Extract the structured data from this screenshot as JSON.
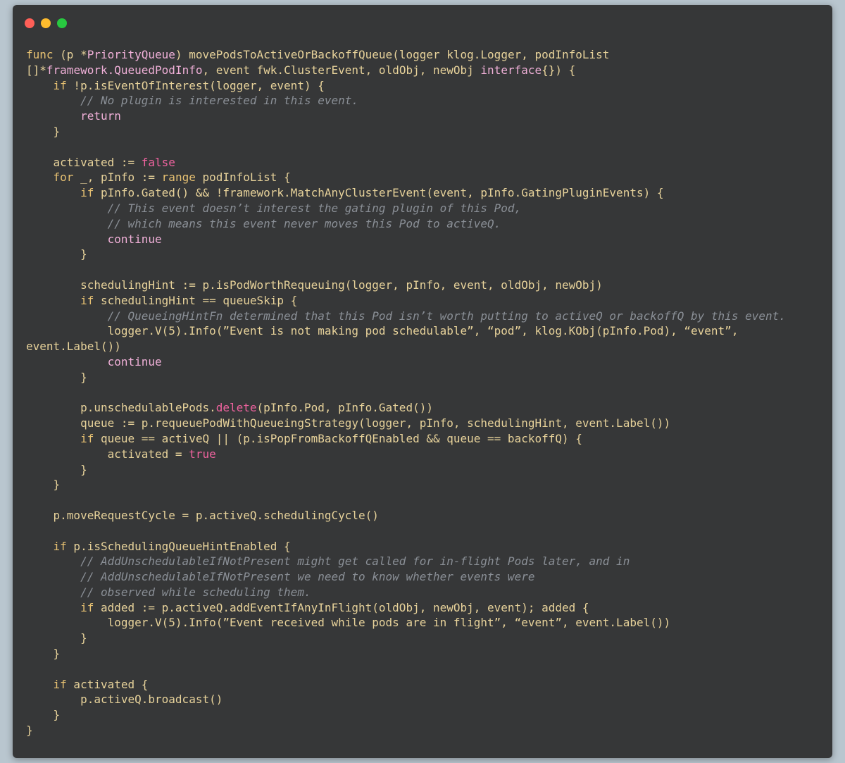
{
  "window": {
    "controls": [
      {
        "name": "close",
        "color": "#ff5f57"
      },
      {
        "name": "minimize",
        "color": "#febc2e"
      },
      {
        "name": "maximize",
        "color": "#28c840"
      }
    ]
  },
  "colors": {
    "background": "#b9c6cf",
    "editor": "#363738",
    "text": "#e7d29a",
    "keyword_pink": "#f0639f",
    "comment": "#8a8f96"
  },
  "code": {
    "language": "go",
    "lines": [
      [
        {
          "t": "func",
          "c": "kw"
        },
        {
          "t": " (p *",
          "c": "pl"
        },
        {
          "t": "PriorityQueue",
          "c": "ty"
        },
        {
          "t": ") movePodsToActiveOrBackoffQueue(logger klog.Logger, podInfoList",
          "c": "pl"
        }
      ],
      [
        {
          "t": "[]*",
          "c": "pl"
        },
        {
          "t": "framework.QueuedPodInfo",
          "c": "ty"
        },
        {
          "t": ", event fwk.ClusterEvent, oldObj, newObj ",
          "c": "pl"
        },
        {
          "t": "interface",
          "c": "ty"
        },
        {
          "t": "{}) {",
          "c": "pl"
        }
      ],
      [
        {
          "t": "    ",
          "c": "pl"
        },
        {
          "t": "if",
          "c": "kw"
        },
        {
          "t": " !p.isEventOfInterest(logger, event) {",
          "c": "pl"
        }
      ],
      [
        {
          "t": "        ",
          "c": "pl"
        },
        {
          "t": "// No plugin is interested in this event.",
          "c": "cm"
        }
      ],
      [
        {
          "t": "        ",
          "c": "pl"
        },
        {
          "t": "return",
          "c": "ty"
        }
      ],
      [
        {
          "t": "    }",
          "c": "pl"
        }
      ],
      [
        {
          "t": "",
          "c": "pl"
        }
      ],
      [
        {
          "t": "    activated := ",
          "c": "pl"
        },
        {
          "t": "false",
          "c": "kw2"
        }
      ],
      [
        {
          "t": "    ",
          "c": "pl"
        },
        {
          "t": "for",
          "c": "kw"
        },
        {
          "t": " _, pInfo := ",
          "c": "pl"
        },
        {
          "t": "range",
          "c": "kw"
        },
        {
          "t": " podInfoList {",
          "c": "pl"
        }
      ],
      [
        {
          "t": "        ",
          "c": "pl"
        },
        {
          "t": "if",
          "c": "kw"
        },
        {
          "t": " pInfo.Gated() && !framework.MatchAnyClusterEvent(event, pInfo.GatingPluginEvents) {",
          "c": "pl"
        }
      ],
      [
        {
          "t": "            ",
          "c": "pl"
        },
        {
          "t": "// This event doesn’t interest the gating plugin of this Pod,",
          "c": "cm"
        }
      ],
      [
        {
          "t": "            ",
          "c": "pl"
        },
        {
          "t": "// which means this event never moves this Pod to activeQ.",
          "c": "cm"
        }
      ],
      [
        {
          "t": "            ",
          "c": "pl"
        },
        {
          "t": "continue",
          "c": "ty"
        }
      ],
      [
        {
          "t": "        }",
          "c": "pl"
        }
      ],
      [
        {
          "t": "",
          "c": "pl"
        }
      ],
      [
        {
          "t": "        schedulingHint := p.isPodWorthRequeuing(logger, pInfo, event, oldObj, newObj)",
          "c": "pl"
        }
      ],
      [
        {
          "t": "        ",
          "c": "pl"
        },
        {
          "t": "if",
          "c": "kw"
        },
        {
          "t": " schedulingHint == queueSkip {",
          "c": "pl"
        }
      ],
      [
        {
          "t": "            ",
          "c": "pl"
        },
        {
          "t": "// QueueingHintFn determined that this Pod isn’t worth putting to activeQ or backoffQ by this event.",
          "c": "cm"
        }
      ],
      [
        {
          "t": "            logger.V(5).Info(”Event is not making pod schedulable”, “pod”, klog.KObj(pInfo.Pod), “event”,",
          "c": "pl"
        }
      ],
      [
        {
          "t": "event.Label())",
          "c": "pl"
        }
      ],
      [
        {
          "t": "            ",
          "c": "pl"
        },
        {
          "t": "continue",
          "c": "ty"
        }
      ],
      [
        {
          "t": "        }",
          "c": "pl"
        }
      ],
      [
        {
          "t": "",
          "c": "pl"
        }
      ],
      [
        {
          "t": "        p.unschedulablePods.",
          "c": "pl"
        },
        {
          "t": "delete",
          "c": "kw2"
        },
        {
          "t": "(pInfo.Pod, pInfo.Gated())",
          "c": "pl"
        }
      ],
      [
        {
          "t": "        queue := p.requeuePodWithQueueingStrategy(logger, pInfo, schedulingHint, event.Label())",
          "c": "pl"
        }
      ],
      [
        {
          "t": "        ",
          "c": "pl"
        },
        {
          "t": "if",
          "c": "kw"
        },
        {
          "t": " queue == activeQ || (p.isPopFromBackoffQEnabled && queue == backoffQ) {",
          "c": "pl"
        }
      ],
      [
        {
          "t": "            activated = ",
          "c": "pl"
        },
        {
          "t": "true",
          "c": "kw2"
        }
      ],
      [
        {
          "t": "        }",
          "c": "pl"
        }
      ],
      [
        {
          "t": "    }",
          "c": "pl"
        }
      ],
      [
        {
          "t": "",
          "c": "pl"
        }
      ],
      [
        {
          "t": "    p.moveRequestCycle = p.activeQ.schedulingCycle()",
          "c": "pl"
        }
      ],
      [
        {
          "t": "",
          "c": "pl"
        }
      ],
      [
        {
          "t": "    ",
          "c": "pl"
        },
        {
          "t": "if",
          "c": "kw"
        },
        {
          "t": " p.isSchedulingQueueHintEnabled {",
          "c": "pl"
        }
      ],
      [
        {
          "t": "        ",
          "c": "pl"
        },
        {
          "t": "// AddUnschedulableIfNotPresent might get called for in-flight Pods later, and in",
          "c": "cm"
        }
      ],
      [
        {
          "t": "        ",
          "c": "pl"
        },
        {
          "t": "// AddUnschedulableIfNotPresent we need to know whether events were",
          "c": "cm"
        }
      ],
      [
        {
          "t": "        ",
          "c": "pl"
        },
        {
          "t": "// observed while scheduling them.",
          "c": "cm"
        }
      ],
      [
        {
          "t": "        ",
          "c": "pl"
        },
        {
          "t": "if",
          "c": "kw"
        },
        {
          "t": " added := p.activeQ.addEventIfAnyInFlight(oldObj, newObj, event); added {",
          "c": "pl"
        }
      ],
      [
        {
          "t": "            logger.V(5).Info(”Event received while pods are in flight”, “event”, event.Label())",
          "c": "pl"
        }
      ],
      [
        {
          "t": "        }",
          "c": "pl"
        }
      ],
      [
        {
          "t": "    }",
          "c": "pl"
        }
      ],
      [
        {
          "t": "",
          "c": "pl"
        }
      ],
      [
        {
          "t": "    ",
          "c": "pl"
        },
        {
          "t": "if",
          "c": "kw"
        },
        {
          "t": " activated {",
          "c": "pl"
        }
      ],
      [
        {
          "t": "        p.activeQ.broadcast()",
          "c": "pl"
        }
      ],
      [
        {
          "t": "    }",
          "c": "pl"
        }
      ],
      [
        {
          "t": "}",
          "c": "pl"
        }
      ]
    ]
  }
}
